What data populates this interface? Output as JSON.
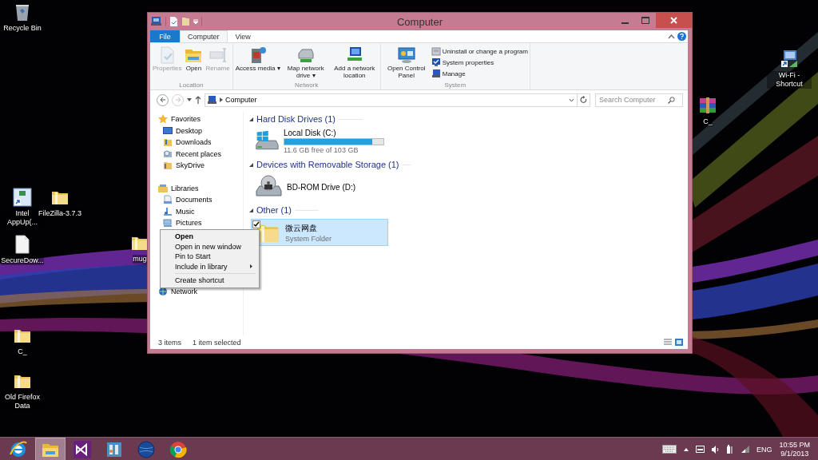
{
  "desktop_icons": [
    {
      "label": "Recycle Bin",
      "kind": "recycle"
    },
    {
      "label": "Intel AppUp(...",
      "kind": "shortcut"
    },
    {
      "label": "FileZilla-3.7.3",
      "kind": "folder"
    },
    {
      "label": "SecureDow...",
      "kind": "file"
    },
    {
      "label": "mug",
      "kind": "folder"
    },
    {
      "label": "C_",
      "kind": "folder"
    },
    {
      "label": "Old Firefox Data",
      "kind": "folder"
    },
    {
      "label": "Wi-Fi - Shortcut",
      "kind": "network"
    },
    {
      "label": "C_",
      "kind": "archive"
    }
  ],
  "window": {
    "title": "Computer",
    "tabs": [
      {
        "label": "File",
        "kind": "file",
        "selected": false
      },
      {
        "label": "Computer",
        "kind": "tab",
        "selected": true
      },
      {
        "label": "View",
        "kind": "tab",
        "selected": false
      }
    ],
    "ribbon_groups": [
      {
        "label": "Location",
        "buttons": [
          {
            "label": "Properties",
            "kind": "properties",
            "disabled": true
          },
          {
            "label": "Open",
            "kind": "open",
            "disabled": false
          },
          {
            "label": "Rename",
            "kind": "rename",
            "disabled": true
          }
        ]
      },
      {
        "label": "Network",
        "buttons": [
          {
            "label": "Access media ▾",
            "kind": "media",
            "disabled": false
          },
          {
            "label": "Map network drive ▾",
            "kind": "mapdrive",
            "disabled": false
          },
          {
            "label": "Add a network location",
            "kind": "netloc",
            "disabled": false
          }
        ]
      },
      {
        "label": "System",
        "buttons": [
          {
            "label": "Open Control Panel",
            "kind": "control",
            "disabled": false
          }
        ],
        "small_buttons": [
          {
            "label": "Uninstall or change a program",
            "kind": "uninstall"
          },
          {
            "label": "System properties",
            "kind": "sysprops"
          },
          {
            "label": "Manage",
            "kind": "manage"
          }
        ]
      }
    ],
    "address": {
      "path": "Computer"
    },
    "search": {
      "placeholder": "Search Computer"
    },
    "nav_sections": [
      {
        "label": "Favorites",
        "kind": "favorites",
        "children": [
          {
            "label": "Desktop",
            "kind": "desktop"
          },
          {
            "label": "Downloads",
            "kind": "downloads"
          },
          {
            "label": "Recent places",
            "kind": "recent"
          },
          {
            "label": "SkyDrive",
            "kind": "skydrive"
          }
        ]
      },
      {
        "label": "Libraries",
        "kind": "libraries",
        "children": [
          {
            "label": "Documents",
            "kind": "documents"
          },
          {
            "label": "Music",
            "kind": "music"
          },
          {
            "label": "Pictures",
            "kind": "pictures"
          }
        ]
      },
      {
        "label": "Network",
        "kind": "network"
      }
    ],
    "groups": [
      {
        "label": "Hard Disk Drives (1)",
        "items": [
          {
            "name": "Local Disk (C:)",
            "kind": "disk",
            "level": 0.89,
            "detail": "11.6 GB free of 103 GB",
            "selected": false,
            "checked": false
          }
        ]
      },
      {
        "label": "Devices with Removable Storage (1)",
        "items": [
          {
            "name": "BD-ROM Drive (D:)",
            "kind": "bd",
            "selected": false,
            "checked": false
          }
        ]
      },
      {
        "label": "Other (1)",
        "items": [
          {
            "name": "微云网盘",
            "kind": "folder",
            "detail": "System Folder",
            "selected": true,
            "checked": true
          }
        ]
      }
    ],
    "context_menu": [
      {
        "kind": "item",
        "label": "Open",
        "default": true,
        "submenu": false
      },
      {
        "kind": "item",
        "label": "Open in new window",
        "default": false,
        "submenu": false
      },
      {
        "kind": "item",
        "label": "Pin to Start",
        "default": false,
        "submenu": false
      },
      {
        "kind": "item",
        "label": "Include in library",
        "default": false,
        "submenu": true
      },
      {
        "kind": "separator"
      },
      {
        "kind": "item",
        "label": "Create shortcut",
        "default": false,
        "submenu": false
      }
    ],
    "status_bar": {
      "count": "3 items",
      "selection": "1 item selected"
    }
  },
  "taskbar": {
    "apps": [
      {
        "kind": "ie",
        "active": false
      },
      {
        "kind": "explorer",
        "active": true
      },
      {
        "kind": "vs",
        "active": false
      },
      {
        "kind": "jb",
        "active": false
      },
      {
        "kind": "globe",
        "active": false
      },
      {
        "kind": "chrome",
        "active": false
      }
    ],
    "language": "ENG",
    "time": "10:55 PM",
    "date": "9/1/2013"
  }
}
